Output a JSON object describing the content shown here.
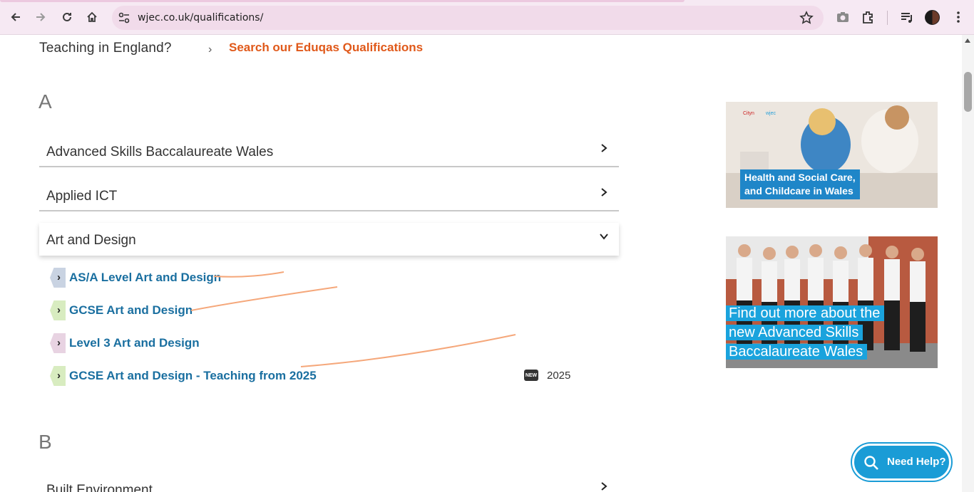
{
  "browser": {
    "url": "wjec.co.uk/qualifications/",
    "icons": [
      "back-icon",
      "forward-icon",
      "reload-icon",
      "home-icon",
      "site-settings-icon",
      "star-icon",
      "camera-icon",
      "extensions-icon",
      "media-icon",
      "profile-avatar",
      "menu-icon"
    ]
  },
  "header": {
    "teaching_text": "Teaching in England?",
    "eduqas_link": "Search our Eduqas Qualifications"
  },
  "sections": [
    {
      "letter": "A",
      "items": [
        {
          "label": "Advanced Skills Baccalaureate Wales",
          "open": false
        },
        {
          "label": "Applied ICT",
          "open": false
        },
        {
          "label": "Art and Design",
          "open": true,
          "subitems": [
            {
              "label": "AS/A Level Art and Design",
              "tag_color": "#c9d3e2"
            },
            {
              "label": "GCSE Art and Design",
              "tag_color": "#d8ecc0"
            },
            {
              "label": "Level 3 Art and Design",
              "tag_color": "#e8d3e2"
            },
            {
              "label": "GCSE Art and Design - Teaching from 2025",
              "tag_color": "#d8ecc0",
              "badge": "NEW",
              "year": "2025"
            }
          ]
        }
      ]
    },
    {
      "letter": "B",
      "items": [
        {
          "label": "Built Environment",
          "open": false
        }
      ]
    }
  ],
  "promos": {
    "promo1_caption_line1": "Health and Social Care,",
    "promo1_caption_line2": "and Childcare in Wales",
    "promo2_caption_line1": "Find out more about the",
    "promo2_caption_line2": "new Advanced Skills",
    "promo2_caption_line3": "Baccalaureate Wales"
  },
  "help_button": "Need Help?",
  "colors": {
    "accent_orange": "#e0591a",
    "link_blue": "#1a6fa0",
    "help_blue": "#1a9cd6"
  }
}
